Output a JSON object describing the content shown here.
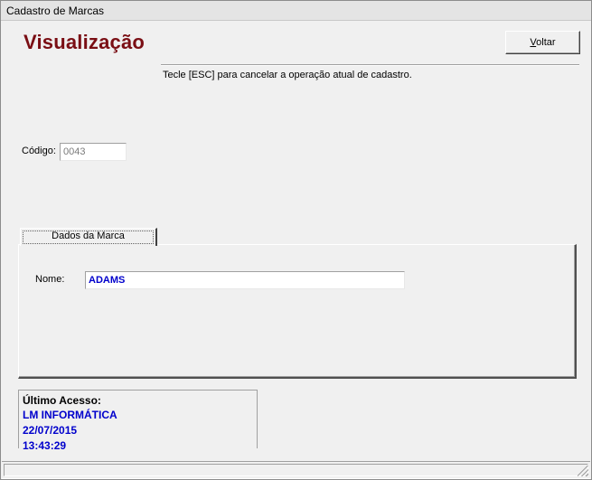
{
  "window": {
    "title": "Cadastro de Marcas"
  },
  "header": {
    "mode_title": "Visualização",
    "back_button_accel": "V",
    "back_button_rest": "oltar",
    "hint": "Tecle [ESC] para cancelar a operação atual de cadastro."
  },
  "form": {
    "codigo_label": "Código:",
    "codigo_value": "0043"
  },
  "tabs": {
    "items": [
      {
        "label": "Dados da Marca",
        "selected": true
      }
    ]
  },
  "marca": {
    "nome_label": "Nome:",
    "nome_value": "ADAMS"
  },
  "access": {
    "title": "Último Acesso:",
    "user": "LM INFORMÁTICA",
    "date": "22/07/2015",
    "time": "13:43:29"
  },
  "colors": {
    "heading": "#7a0e14",
    "value_text": "#0000cc",
    "window_bg": "#f0f0f0"
  }
}
